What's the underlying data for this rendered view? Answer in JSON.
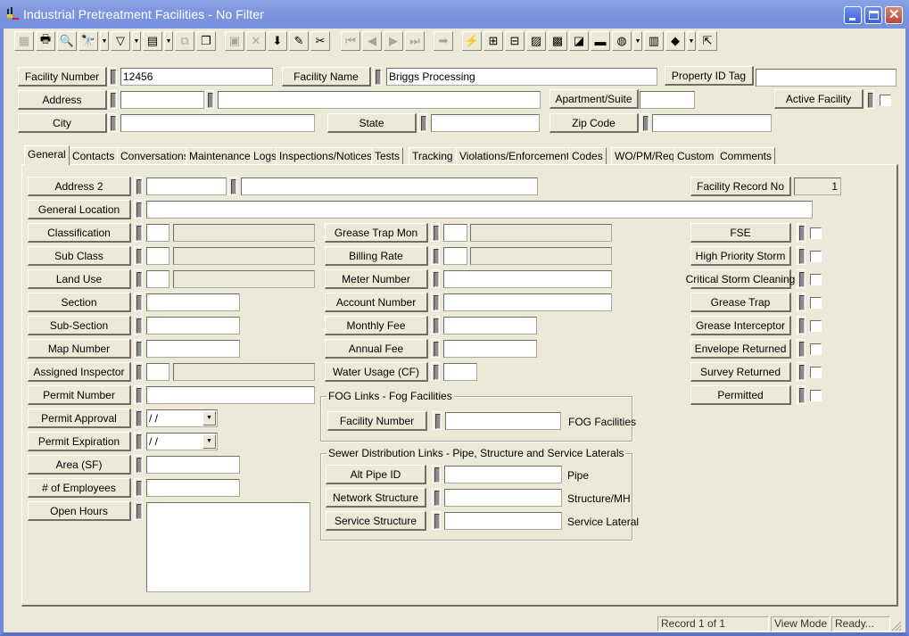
{
  "window": {
    "title": "Industrial Pretreatment Facilities - No Filter",
    "controls": [
      "minimize",
      "maximize",
      "close"
    ]
  },
  "toolbar": {
    "buttons": [
      {
        "name": "record-selector-icon",
        "glyph": "▦",
        "enabled": false
      },
      {
        "name": "print-icon",
        "glyph": "🖶",
        "enabled": true
      },
      {
        "name": "print-preview-icon",
        "glyph": "🔍",
        "enabled": true
      },
      {
        "name": "find-icon",
        "glyph": "🔭",
        "enabled": true,
        "dropdown": true
      },
      {
        "name": "filter-icon",
        "glyph": "▽",
        "enabled": true,
        "dropdown": true
      },
      {
        "name": "report-icon",
        "glyph": "▤",
        "enabled": true,
        "dropdown": true
      },
      {
        "name": "export-icon",
        "glyph": "⧉",
        "enabled": false
      },
      {
        "name": "attach-icon",
        "glyph": "❐",
        "enabled": true
      },
      {
        "name": "save-icon",
        "glyph": "▣",
        "enabled": false
      },
      {
        "name": "delete-icon",
        "glyph": "✕",
        "enabled": false
      },
      {
        "name": "add-record-icon",
        "glyph": "⬇",
        "enabled": true
      },
      {
        "name": "edit-icon",
        "glyph": "✎",
        "enabled": true
      },
      {
        "name": "cut-icon",
        "glyph": "✂",
        "enabled": true
      },
      {
        "name": "first-record-icon",
        "glyph": "⏮",
        "enabled": false
      },
      {
        "name": "previous-record-icon",
        "glyph": "◀",
        "enabled": false
      },
      {
        "name": "next-record-icon",
        "glyph": "▶",
        "enabled": false
      },
      {
        "name": "last-record-icon",
        "glyph": "⏭",
        "enabled": false
      },
      {
        "name": "goto-icon",
        "glyph": "➡",
        "enabled": false
      },
      {
        "name": "lightning-icon",
        "glyph": "⚡",
        "enabled": true
      },
      {
        "name": "hierarchy-icon",
        "glyph": "⊞",
        "enabled": true
      },
      {
        "name": "link-icon",
        "glyph": "⊟",
        "enabled": true
      },
      {
        "name": "map-icon",
        "glyph": "▨",
        "enabled": true
      },
      {
        "name": "calculator-icon",
        "glyph": "▩",
        "enabled": true
      },
      {
        "name": "layers-icon",
        "glyph": "◪",
        "enabled": true
      },
      {
        "name": "toolbox-icon",
        "glyph": "▬",
        "enabled": true
      },
      {
        "name": "globe-icon",
        "glyph": "◍",
        "enabled": true,
        "dropdown": true
      },
      {
        "name": "spreadsheet-icon",
        "glyph": "▥",
        "enabled": true
      },
      {
        "name": "help-book-icon",
        "glyph": "◆",
        "enabled": true,
        "dropdown": true
      },
      {
        "name": "exit-icon",
        "glyph": "⇱",
        "enabled": true
      }
    ]
  },
  "header": {
    "facility_number": {
      "label": "Facility Number",
      "value": "12456"
    },
    "facility_name": {
      "label": "Facility Name",
      "value": "Briggs Processing"
    },
    "property_id_tag": {
      "label": "Property ID Tag",
      "value": ""
    },
    "address": {
      "label": "Address",
      "value1": "",
      "value2": ""
    },
    "apartment_suite": {
      "label": "Apartment/Suite",
      "value": ""
    },
    "active_facility": {
      "label": "Active Facility",
      "checked": false
    },
    "city": {
      "label": "City",
      "value": ""
    },
    "state": {
      "label": "State",
      "value": ""
    },
    "zip_code": {
      "label": "Zip Code",
      "value": ""
    }
  },
  "tabs": [
    {
      "label": "General",
      "active": true
    },
    {
      "label": "Contacts",
      "active": false
    },
    {
      "label": "Conversations",
      "active": false
    },
    {
      "label": "Maintenance Logs",
      "active": false
    },
    {
      "label": "Inspections/Notices",
      "active": false
    },
    {
      "label": "Tests",
      "active": false
    },
    {
      "label": "Tracking",
      "active": false
    },
    {
      "label": "Violations/Enforcements",
      "active": false
    },
    {
      "label": "Codes",
      "active": false
    },
    {
      "label": "WO/PM/Req",
      "active": false
    },
    {
      "label": "Custom",
      "active": false
    },
    {
      "label": "Comments",
      "active": false
    }
  ],
  "general": {
    "address2": {
      "label": "Address 2",
      "value1": "",
      "value2": ""
    },
    "general_location": {
      "label": "General Location",
      "value": ""
    },
    "classification": {
      "label": "Classification",
      "code": "",
      "desc": ""
    },
    "sub_class": {
      "label": "Sub Class",
      "code": "",
      "desc": ""
    },
    "land_use": {
      "label": "Land Use",
      "code": "",
      "desc": ""
    },
    "section": {
      "label": "Section",
      "value": ""
    },
    "sub_section": {
      "label": "Sub-Section",
      "value": ""
    },
    "map_number": {
      "label": "Map Number",
      "value": ""
    },
    "assigned_inspector": {
      "label": "Assigned Inspector",
      "code": "",
      "desc": ""
    },
    "permit_number": {
      "label": "Permit Number",
      "value": ""
    },
    "permit_approval": {
      "label": "Permit Approval",
      "value": " / /"
    },
    "permit_expiration": {
      "label": "Permit Expiration",
      "value": " / /"
    },
    "area_sf": {
      "label": "Area (SF)",
      "value": ""
    },
    "num_employees": {
      "label": "# of Employees",
      "value": ""
    },
    "open_hours": {
      "label": "Open Hours",
      "value": ""
    },
    "grease_trap_mon": {
      "label": "Grease Trap Mon",
      "code": "",
      "desc": ""
    },
    "billing_rate": {
      "label": "Billing Rate",
      "code": "",
      "desc": ""
    },
    "meter_number": {
      "label": "Meter Number",
      "value": ""
    },
    "account_number": {
      "label": "Account Number",
      "value": ""
    },
    "monthly_fee": {
      "label": "Monthly Fee",
      "value": ""
    },
    "annual_fee": {
      "label": "Annual Fee",
      "value": ""
    },
    "water_usage": {
      "label": "Water Usage (CF)",
      "value": ""
    },
    "facility_record_no": {
      "label": "Facility Record No",
      "value": "1"
    },
    "fog_group": {
      "title": "FOG Links - Fog Facilities",
      "facility_number": {
        "label": "Facility Number",
        "value": "",
        "suffix": "FOG Facilities"
      }
    },
    "sewer_group": {
      "title": "Sewer Distribution Links - Pipe, Structure and Service Laterals",
      "alt_pipe_id": {
        "label": "Alt Pipe ID",
        "value": "",
        "suffix": "Pipe"
      },
      "network_structure": {
        "label": "Network Structure",
        "value": "",
        "suffix": "Structure/MH"
      },
      "service_structure": {
        "label": "Service Structure",
        "value": "",
        "suffix": "Service Lateral"
      }
    },
    "flags": [
      {
        "label": "FSE",
        "checked": false
      },
      {
        "label": "High Priority Storm",
        "checked": false
      },
      {
        "label": "Critical Storm Cleaning",
        "checked": false
      },
      {
        "label": "Grease Trap",
        "checked": false
      },
      {
        "label": "Grease Interceptor",
        "checked": false
      },
      {
        "label": "Envelope Returned",
        "checked": false
      },
      {
        "label": "Survey Returned",
        "checked": false
      },
      {
        "label": "Permitted",
        "checked": false
      }
    ]
  },
  "status": {
    "record": "Record 1 of 1",
    "mode": "View Mode",
    "state": "Ready..."
  }
}
